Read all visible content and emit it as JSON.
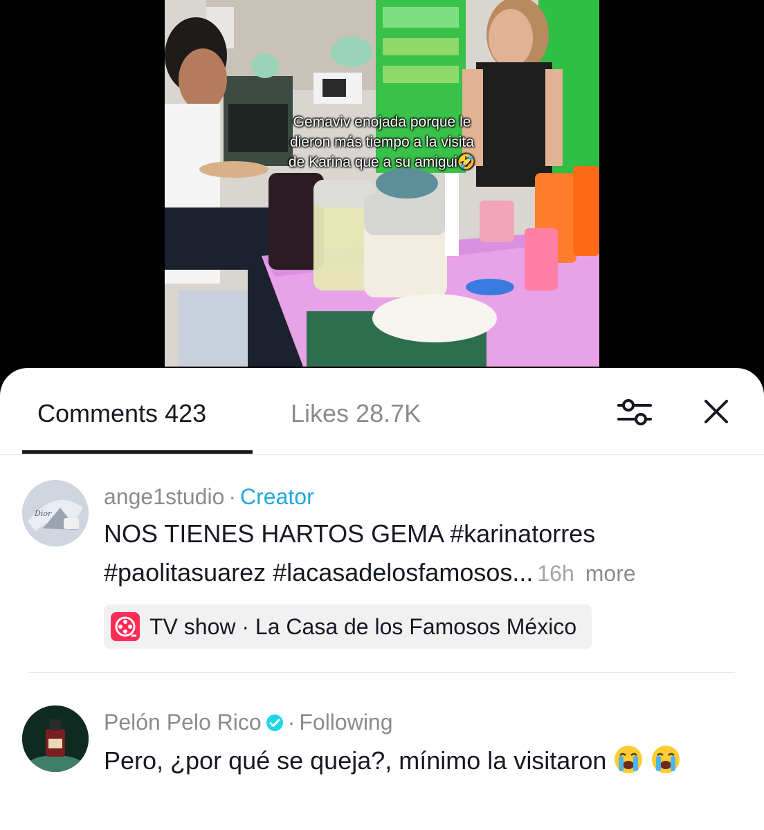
{
  "video": {
    "caption_lines": [
      "Gemaviv enojada porque le",
      "dieron más tiempo a la visita",
      "de Karina que a su amigui🤣"
    ]
  },
  "sheet": {
    "tabs": {
      "comments_label": "Comments 423",
      "likes_label": "Likes 28.7K"
    },
    "icons": {
      "filter": "sliders-icon",
      "close": "close-icon"
    },
    "comments": [
      {
        "username": "ange1studio",
        "separator": "·",
        "badge": "Creator",
        "text": "NOS TIENES HARTOS GEMA #karinatorres #paolitasuarez #lacasadelosfamosos...",
        "time": "16h",
        "more_label": "more",
        "chip": {
          "icon": "film-reel-icon",
          "label": "TV show · La Casa de los Famosos México"
        }
      },
      {
        "username": "Pelón Pelo Rico",
        "verified_icon": "verified-badge-icon",
        "separator": "·",
        "badge": "Following",
        "text": "Pero, ¿por qué se queja?, mínimo la visitaron",
        "emoji": "loudly-crying-face-icon"
      }
    ]
  },
  "colors": {
    "accent_creator": "#20a8d8",
    "chip_icon": "#fe2c55",
    "verified": "#20d5ec",
    "text_primary": "#161823",
    "text_secondary": "#8a8b91"
  }
}
